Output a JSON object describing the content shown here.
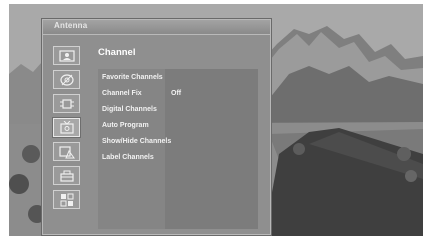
{
  "menu": {
    "header_title": "Antenna",
    "section_title": "Channel",
    "items": [
      {
        "label": "Favorite Channels",
        "value": ""
      },
      {
        "label": "Channel Fix",
        "value": "Off"
      },
      {
        "label": "Digital Channels",
        "value": ""
      },
      {
        "label": "Auto Program",
        "value": ""
      },
      {
        "label": "Show/Hide Channels",
        "value": ""
      },
      {
        "label": "Label Channels",
        "value": ""
      }
    ],
    "side_icons": [
      "picture-icon",
      "audio-icon",
      "network-icon",
      "channel-icon",
      "lock-icon",
      "setup-icon",
      "layout-icon"
    ],
    "active_icon": "channel-icon"
  }
}
